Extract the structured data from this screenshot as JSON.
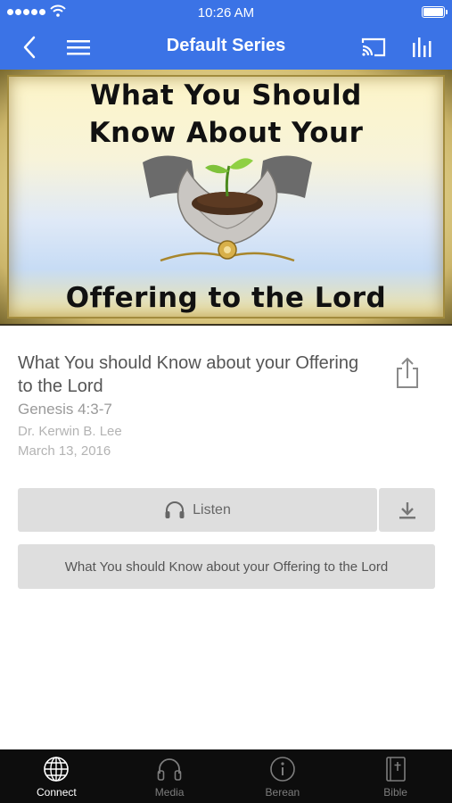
{
  "status_bar": {
    "time": "10:26 AM"
  },
  "nav": {
    "title": "Default Series"
  },
  "hero": {
    "line1": "What You Should",
    "line2": "Know About Your",
    "line3": "Offering to the Lord"
  },
  "sermon": {
    "title": "What You should Know about your Offering to the Lord",
    "scripture": "Genesis 4:3-7",
    "speaker": "Dr. Kerwin B. Lee",
    "date": "March 13, 2016"
  },
  "actions": {
    "listen_label": "Listen",
    "outline_label": "What You should Know about your Offering to the Lord"
  },
  "tabs": [
    {
      "label": "Connect",
      "icon": "globe-icon",
      "active": true
    },
    {
      "label": "Media",
      "icon": "headphones-icon",
      "active": false
    },
    {
      "label": "Berean",
      "icon": "info-icon",
      "active": false
    },
    {
      "label": "Bible",
      "icon": "bible-icon",
      "active": false
    }
  ],
  "colors": {
    "brand": "#3b73e6",
    "tab_bar": "#0d0d0d",
    "button": "#dedede"
  }
}
